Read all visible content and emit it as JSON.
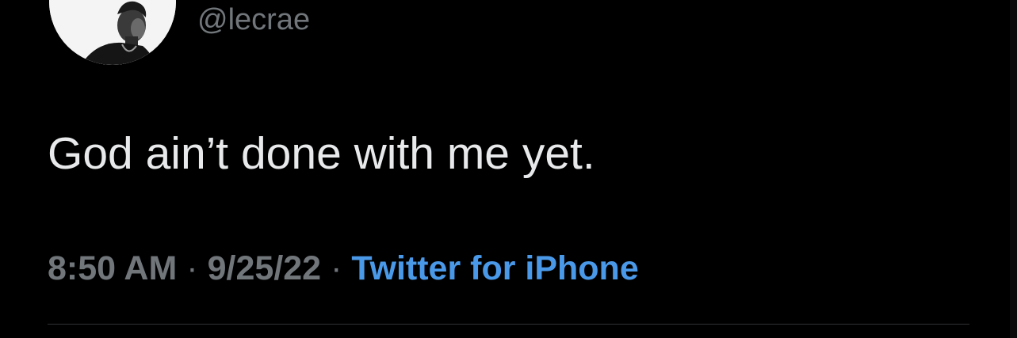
{
  "author": {
    "handle": "@lecrae"
  },
  "tweet": {
    "text": "God ain’t done with me yet."
  },
  "meta": {
    "time": "8:50 AM",
    "separator": "·",
    "date": "9/25/22",
    "source": "Twitter for iPhone"
  },
  "colors": {
    "background": "#000000",
    "text_primary": "#e7e9ea",
    "text_secondary": "#71767b",
    "link": "#4a99e9",
    "divider": "#2f3336"
  }
}
